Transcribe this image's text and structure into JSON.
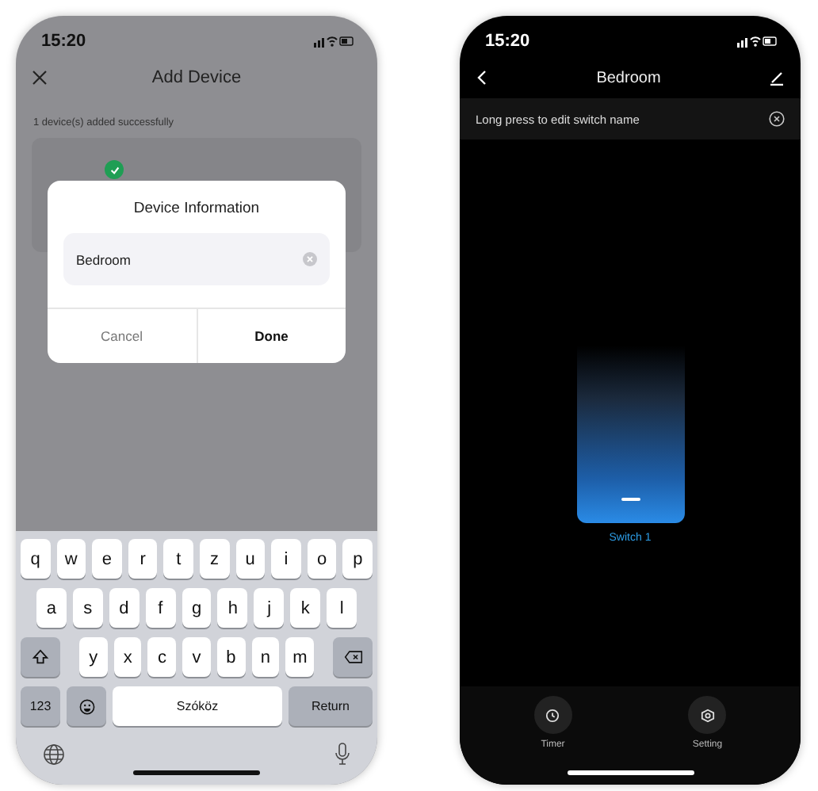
{
  "left_screen": {
    "status_time": "15:20",
    "header": {
      "title": "Add Device"
    },
    "success_message": "1 device(s) added successfully",
    "dialog": {
      "title": "Device Information",
      "field": {
        "value": "Bedroom"
      },
      "buttons": [
        {
          "label": "Cancel",
          "kind": "cancel"
        },
        {
          "label": "Done",
          "kind": "confirm"
        }
      ]
    },
    "keyboard": {
      "rows": [
        [
          "q",
          "w",
          "e",
          "r",
          "t",
          "z",
          "u",
          "i",
          "o",
          "p"
        ],
        [
          "a",
          "s",
          "d",
          "f",
          "g",
          "h",
          "j",
          "k",
          "l"
        ],
        [
          "y",
          "x",
          "c",
          "v",
          "b",
          "n",
          "m"
        ]
      ],
      "numbers_key": "123",
      "space_key": "Szóköz",
      "return_key": "Return"
    }
  },
  "right_screen": {
    "status_time": "15:20",
    "header": {
      "title": "Bedroom"
    },
    "banner": "Long press to edit switch name",
    "switch": {
      "label": "Switch 1"
    },
    "bottom_bar": [
      {
        "label": "Timer",
        "kind": "timer"
      },
      {
        "label": "Setting",
        "kind": "setting"
      }
    ]
  }
}
